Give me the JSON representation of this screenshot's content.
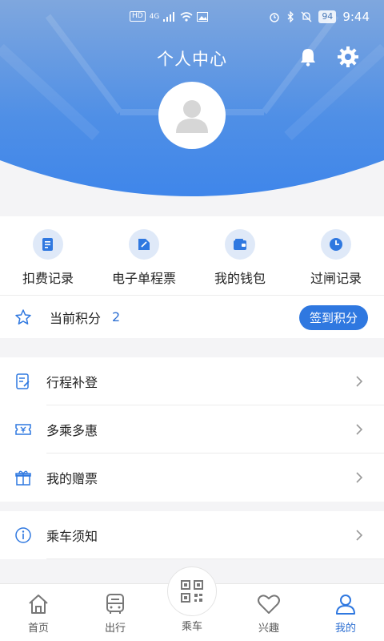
{
  "status_bar": {
    "left_chip": "HD",
    "network": "4G",
    "battery": "94",
    "time": "9:44"
  },
  "header": {
    "title": "个人中心",
    "icons": [
      "bell-icon",
      "gear-icon"
    ]
  },
  "quick_actions": [
    {
      "label": "扣费记录",
      "icon": "receipt-icon"
    },
    {
      "label": "电子单程票",
      "icon": "ticket-tag-icon"
    },
    {
      "label": "我的钱包",
      "icon": "wallet-icon"
    },
    {
      "label": "过闸记录",
      "icon": "clock-icon"
    }
  ],
  "points": {
    "label": "当前积分",
    "value": "2",
    "button": "签到积分"
  },
  "menu_group1": [
    {
      "label": "行程补登",
      "icon": "edit-doc-icon"
    },
    {
      "label": "多乘多惠",
      "icon": "coupon-icon"
    },
    {
      "label": "我的赠票",
      "icon": "gift-icon"
    }
  ],
  "menu_group2": [
    {
      "label": "乘车须知",
      "icon": "info-icon"
    }
  ],
  "nav": [
    {
      "label": "首页",
      "icon": "home-icon"
    },
    {
      "label": "出行",
      "icon": "bus-icon"
    },
    {
      "label": "乘车",
      "icon": "qr-code-icon"
    },
    {
      "label": "兴趣",
      "icon": "heart-icon"
    },
    {
      "label": "我的",
      "icon": "user-icon"
    }
  ],
  "colors": {
    "primary": "#2f78e0",
    "header_top": "#6f9fde",
    "header_bottom": "#3f86ea"
  }
}
